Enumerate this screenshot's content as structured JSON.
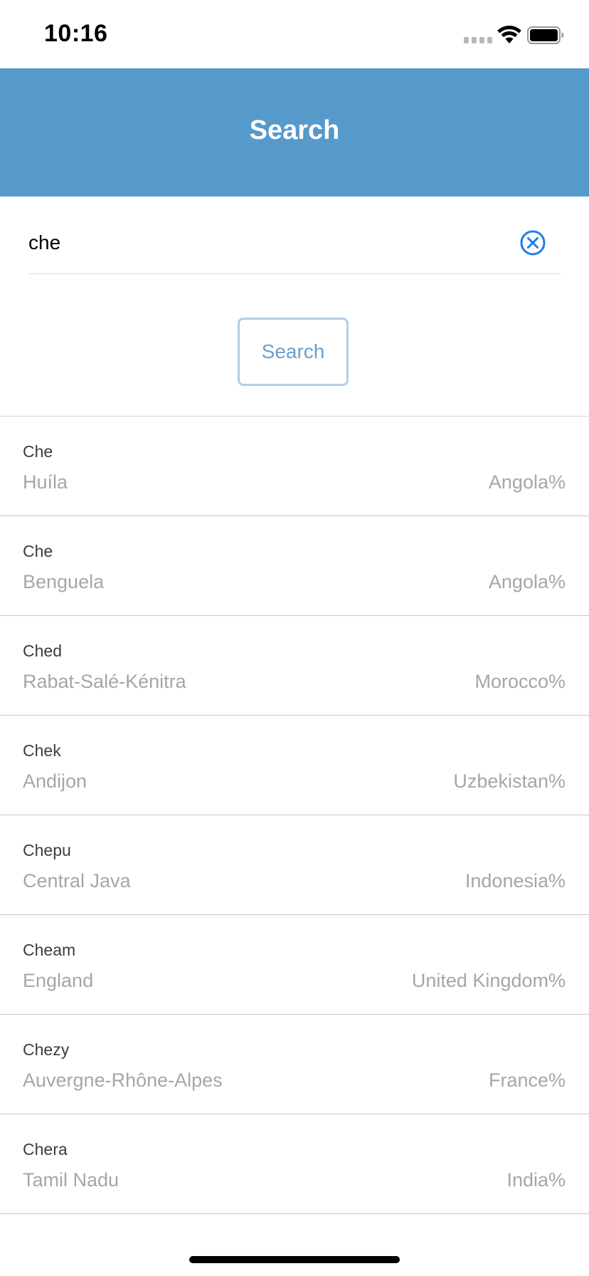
{
  "status_bar": {
    "time": "10:16"
  },
  "nav": {
    "title": "Search"
  },
  "search": {
    "value": "che",
    "button_label": "Search"
  },
  "results": [
    {
      "name": "Che",
      "region": "Huíla",
      "country": "Angola%"
    },
    {
      "name": "Che",
      "region": "Benguela",
      "country": "Angola%"
    },
    {
      "name": "Ched",
      "region": "Rabat-Salé-Kénitra",
      "country": "Morocco%"
    },
    {
      "name": "Chek",
      "region": "Andijon",
      "country": "Uzbekistan%"
    },
    {
      "name": "Chepu",
      "region": "Central Java",
      "country": "Indonesia%"
    },
    {
      "name": "Cheam",
      "region": "England",
      "country": "United Kingdom%"
    },
    {
      "name": "Chezy",
      "region": "Auvergne-Rhône-Alpes",
      "country": "France%"
    },
    {
      "name": "Chera",
      "region": "Tamil Nadu",
      "country": "India%"
    }
  ],
  "icons": {
    "wifi": "wifi-icon",
    "battery": "battery-icon",
    "signal": "cellular-signal-icon",
    "clear": "clear-circle-x-icon"
  },
  "colors": {
    "nav_background": "#5699cb",
    "accent": "#1a7fe8",
    "button_text": "#6a9fcc",
    "button_border": "#b3cde4",
    "secondary_text": "#a6a6a6"
  }
}
